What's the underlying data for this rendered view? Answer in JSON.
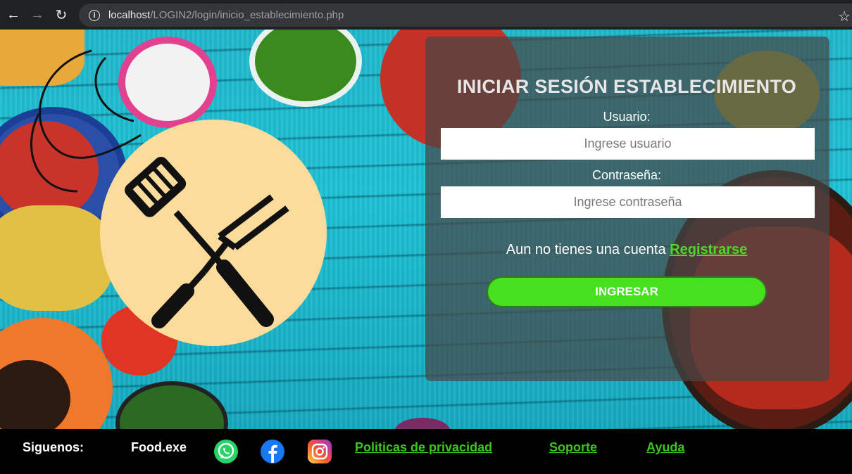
{
  "browser": {
    "url_host": "localhost",
    "url_path": "/LOGIN2/login/inicio_establecimiento.php"
  },
  "login": {
    "title": "INICIAR SESIÓN ESTABLECIMIENTO",
    "user_label": "Usuario:",
    "user_placeholder": "Ingrese usuario",
    "password_label": "Contraseña:",
    "password_placeholder": "Ingrese contraseña",
    "register_prompt": "Aun no tienes una cuenta ",
    "register_link": "Registrarse",
    "submit_label": "INGRESAR"
  },
  "footer": {
    "follow_label": "Siguenos:",
    "brand": "Food.exe",
    "social": [
      "whatsapp-icon",
      "facebook-icon",
      "instagram-icon"
    ],
    "links": {
      "privacy": "Politicas de privacidad",
      "support": "Soporte",
      "help": "Ayuda"
    }
  },
  "colors": {
    "accent_green": "#46e01e",
    "link_green": "#3ec41f",
    "logo_bg": "#fcdc9c"
  }
}
